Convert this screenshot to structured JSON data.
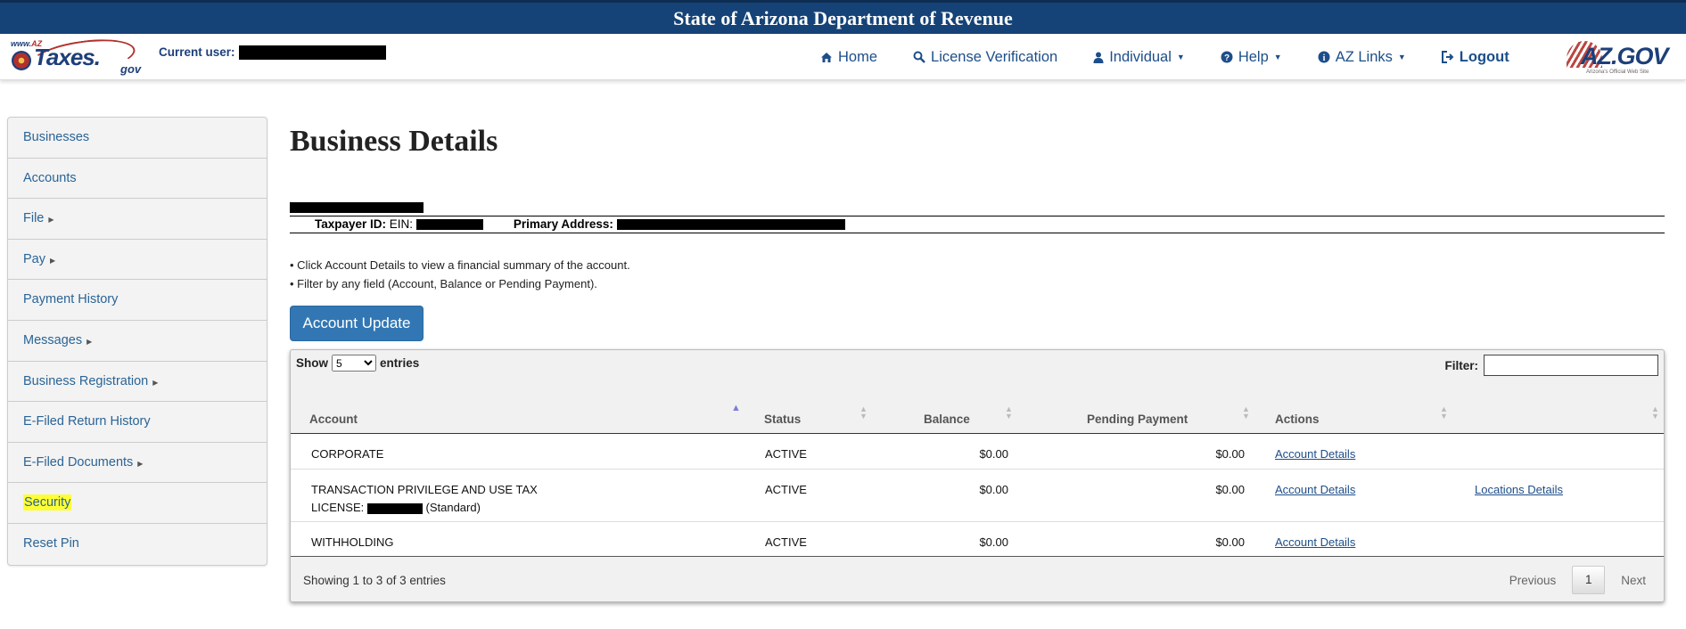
{
  "header": {
    "title": "State of Arizona Department of Revenue",
    "logo_www": "www.",
    "logo_az": "AZ",
    "logo_taxes": "Taxes.",
    "logo_gov": "gov",
    "current_user_label": "Current user:",
    "azgov_logo": "AZ.GOV",
    "azgov_sub": "Arizona's Official Web Site"
  },
  "nav": {
    "home": "Home",
    "license": "License Verification",
    "individual": "Individual",
    "help": "Help",
    "azlinks": "AZ Links",
    "logout": "Logout",
    "icons": {
      "home": "house-icon",
      "license": "search-icon",
      "individual": "user-icon",
      "help": "question-circle-icon",
      "azlinks": "info-circle-icon",
      "logout": "sign-out-icon"
    }
  },
  "sidebar": {
    "items": [
      {
        "label": "Businesses"
      },
      {
        "label": "Accounts"
      },
      {
        "label": "File"
      },
      {
        "label": "Pay"
      },
      {
        "label": "Payment History"
      },
      {
        "label": "Messages"
      },
      {
        "label": "Business Registration"
      },
      {
        "label": "E-Filed Return History"
      },
      {
        "label": "E-Filed Documents"
      },
      {
        "label": "Security"
      },
      {
        "label": "Reset Pin"
      }
    ],
    "highlight_color": "#ffff33"
  },
  "main": {
    "title": "Business Details",
    "taxpayer_id_label": "Taxpayer ID:",
    "ein_label": "EIN:",
    "primary_address_label": "Primary Address:",
    "bullet1": "• Click Account Details to view a financial summary of the account.",
    "bullet2": "• Filter by any field (Account, Balance or Pending Payment).",
    "update_button": "Account Update"
  },
  "table": {
    "show_label": "Show",
    "entries_label": "entries",
    "page_size": "5",
    "filter_label": "Filter:",
    "filter_value": "",
    "columns": [
      "Account",
      "Status",
      "Balance",
      "Pending Payment",
      "Actions"
    ],
    "rows": [
      {
        "account": "CORPORATE",
        "status": "ACTIVE",
        "balance": "$0.00",
        "pending": "$0.00",
        "action": "Account Details"
      },
      {
        "account": "TRANSACTION PRIVILEGE AND USE TAX",
        "license_label": "LICENSE:",
        "license_type": "(Standard)",
        "status": "ACTIVE",
        "balance": "$0.00",
        "pending": "$0.00",
        "action": "Account Details",
        "extra_action": "Locations Details"
      },
      {
        "account": "WITHHOLDING",
        "status": "ACTIVE",
        "balance": "$0.00",
        "pending": "$0.00",
        "action": "Account Details"
      }
    ],
    "info": "Showing 1 to 3 of 3 entries",
    "previous": "Previous",
    "page": "1",
    "next": "Next"
  }
}
